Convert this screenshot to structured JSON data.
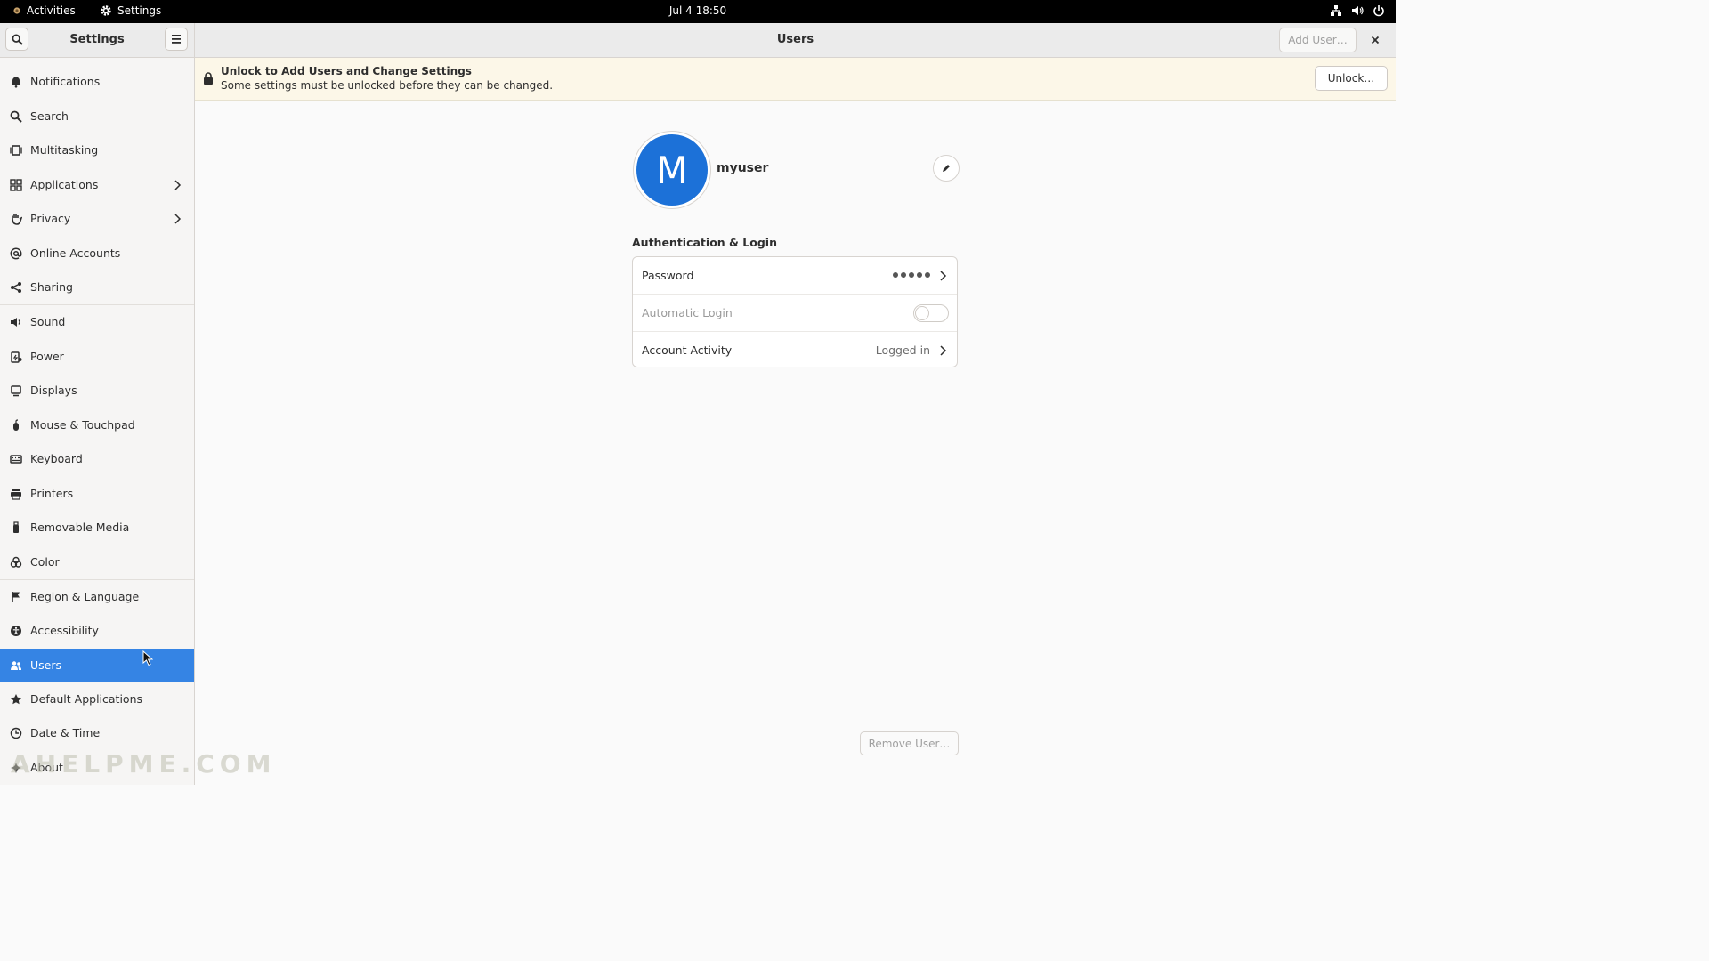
{
  "topbar": {
    "activities_label": "Activities",
    "app_label": "Settings",
    "clock": "Jul 4  18:50",
    "tray_icons": [
      "network-icon",
      "volume-icon",
      "power-icon"
    ]
  },
  "sidebar": {
    "title": "Settings",
    "items": [
      {
        "label": "Notifications",
        "icon": "bell-icon"
      },
      {
        "label": "Search",
        "icon": "search-icon"
      },
      {
        "label": "Multitasking",
        "icon": "multitasking-icon"
      },
      {
        "label": "Applications",
        "icon": "grid-icon",
        "chevron": true
      },
      {
        "label": "Privacy",
        "icon": "hand-icon",
        "chevron": true
      },
      {
        "label": "Online Accounts",
        "icon": "at-icon"
      },
      {
        "label": "Sharing",
        "icon": "share-icon"
      },
      {
        "label": "Sound",
        "icon": "speaker-icon"
      },
      {
        "label": "Power",
        "icon": "power-battery-icon"
      },
      {
        "label": "Displays",
        "icon": "display-icon"
      },
      {
        "label": "Mouse & Touchpad",
        "icon": "mouse-icon"
      },
      {
        "label": "Keyboard",
        "icon": "keyboard-icon"
      },
      {
        "label": "Printers",
        "icon": "printer-icon"
      },
      {
        "label": "Removable Media",
        "icon": "usb-icon"
      },
      {
        "label": "Color",
        "icon": "color-icon"
      },
      {
        "label": "Region & Language",
        "icon": "flag-icon"
      },
      {
        "label": "Accessibility",
        "icon": "accessibility-icon"
      },
      {
        "label": "Users",
        "icon": "users-icon",
        "selected": true
      },
      {
        "label": "Default Applications",
        "icon": "star-icon"
      },
      {
        "label": "Date & Time",
        "icon": "clock-icon"
      },
      {
        "label": "About",
        "icon": "sparkle-icon"
      }
    ]
  },
  "main": {
    "title": "Users",
    "add_user_label": "Add User…",
    "banner": {
      "title": "Unlock to Add Users and Change Settings",
      "subtitle": "Some settings must be unlocked before they can be changed.",
      "unlock_label": "Unlock…"
    },
    "user": {
      "avatar_letter": "M",
      "name": "myuser",
      "avatar_color": "#1c71d8"
    },
    "auth": {
      "heading": "Authentication & Login",
      "password_label": "Password",
      "password_dots": 5,
      "auto_login_label": "Automatic Login",
      "auto_login_on": false,
      "activity_label": "Account Activity",
      "activity_value": "Logged in"
    },
    "remove_user_label": "Remove User…"
  },
  "watermark": "AHELPME.COM",
  "colors": {
    "accent": "#3584e4",
    "banner_bg": "#fcf7e8"
  }
}
